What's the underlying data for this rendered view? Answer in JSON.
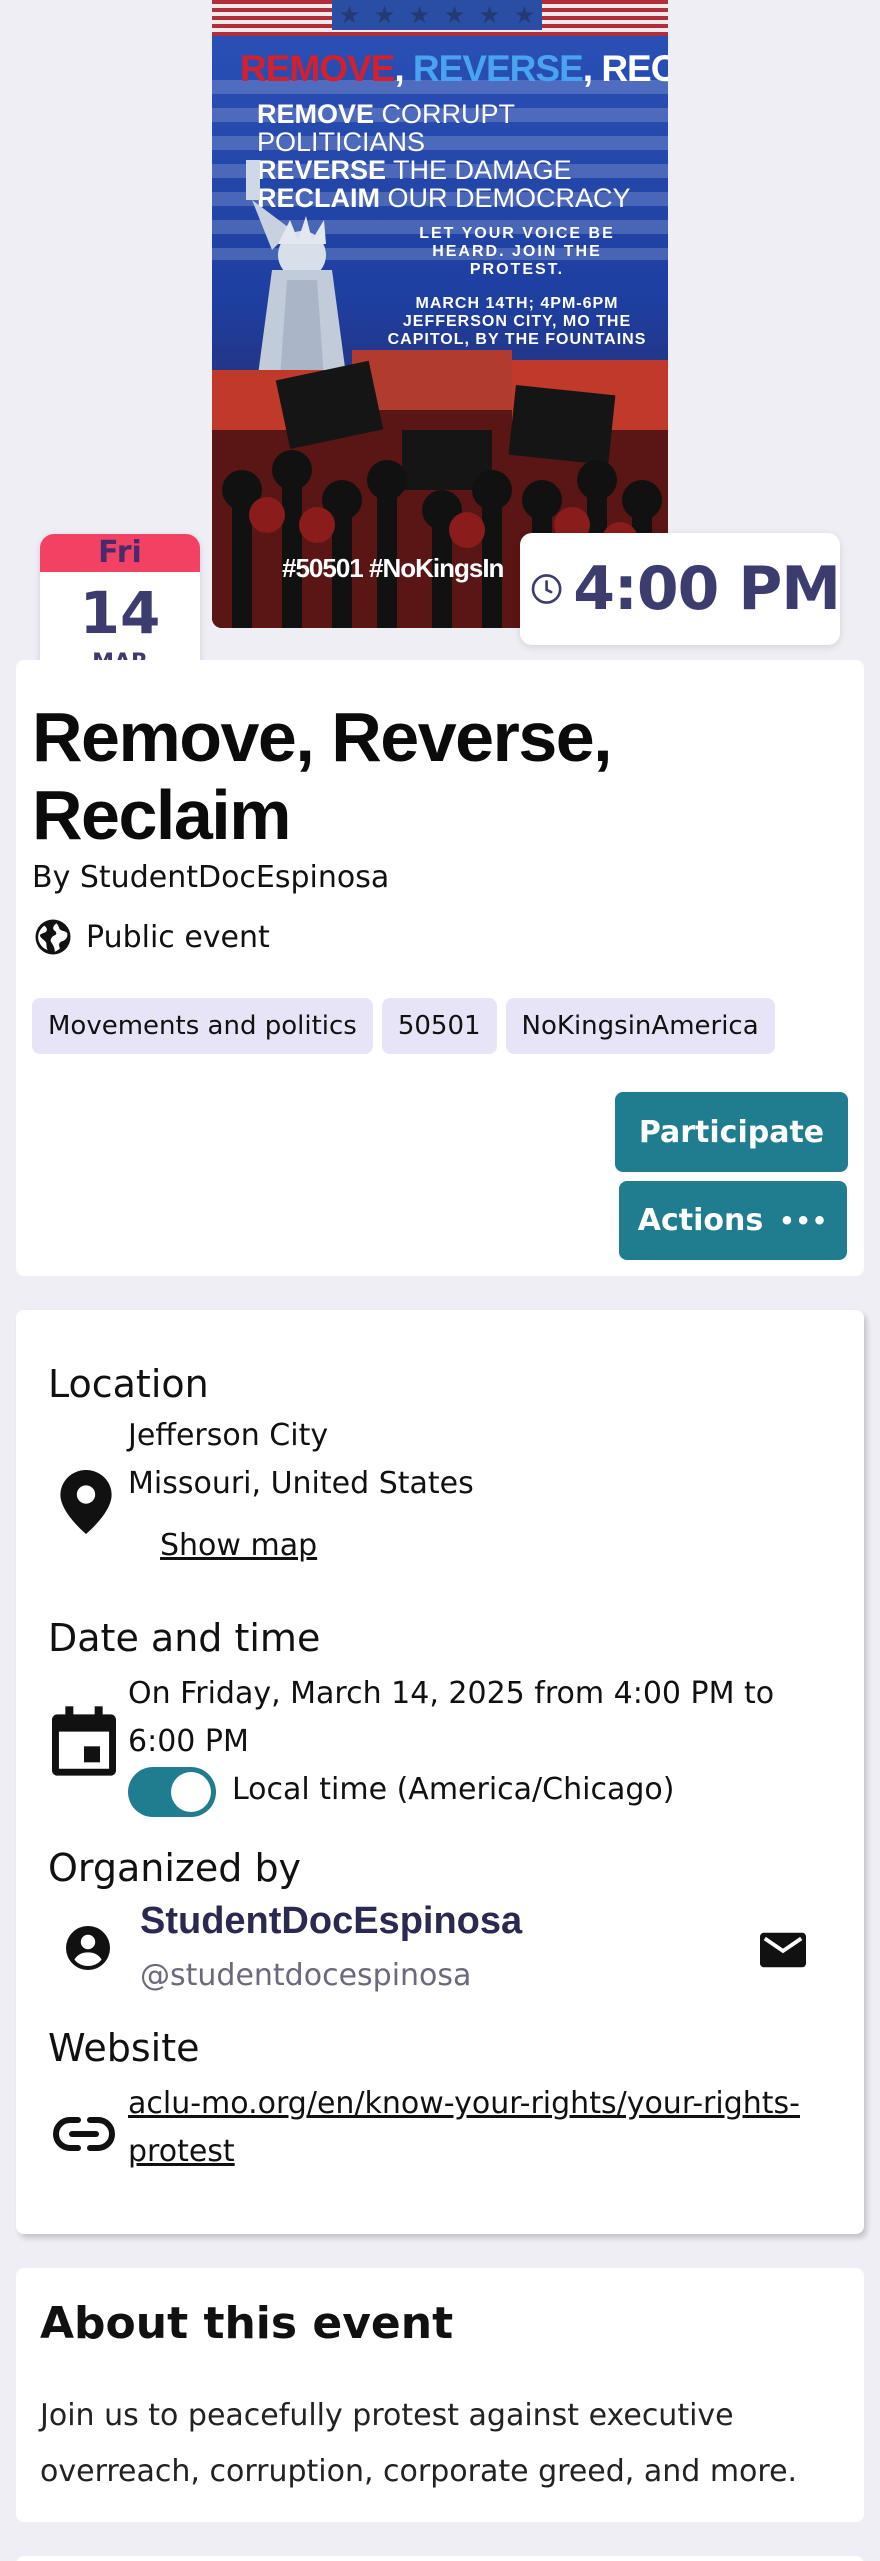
{
  "poster": {
    "headline_1": "REMOVE",
    "headline_sep_1": ", ",
    "headline_2": "REVERSE",
    "headline_sep_2": ", ",
    "headline_3": "RECLAIM",
    "line_1_bold": "REMOVE",
    "line_1_rest": " CORRUPT POLITICIANS",
    "line_2_bold": "REVERSE",
    "line_2_rest": " THE DAMAGE",
    "line_3_bold": "RECLAIM",
    "line_3_rest": " OUR DEMOCRACY",
    "message": "LET YOUR VOICE BE HEARD. JOIN THE PROTEST.",
    "details": "MARCH 14TH; 4PM-6PM JEFFERSON CITY, MO THE CAPITOL, BY THE FOUNTAINS",
    "hashtags": "#50501 #NoKingsIn"
  },
  "date_badge": {
    "weekday": "Fri",
    "day": "14",
    "month": "MAR"
  },
  "time_badge": {
    "time": "4:00 PM"
  },
  "event": {
    "title": "Remove, Reverse, Reclaim",
    "byline": "By StudentDocEspinosa",
    "visibility": "Public event",
    "tags": [
      "Movements and politics",
      "50501",
      "NoKingsinAmerica"
    ],
    "participate_label": "Participate",
    "actions_label": "Actions"
  },
  "details": {
    "location_heading": "Location",
    "location_line1": "Jefferson City",
    "location_line2": "Missouri, United States",
    "show_map_label": "Show map",
    "datetime_heading": "Date and time",
    "datetime_text": "On Friday, March 14, 2025 from 4:00 PM to 6:00 PM",
    "local_time_label": "Local time (America/Chicago)",
    "local_time_enabled": true,
    "organizer_heading": "Organized by",
    "organizer_name": "StudentDocEspinosa",
    "organizer_handle": "@studentdocespinosa",
    "website_heading": "Website",
    "website_url": "aclu-mo.org/en/know-your-rights/your-rights-protest"
  },
  "about": {
    "heading": "About this event",
    "body": "Join us to peacefully protest against executive overreach, corruption, corporate greed, and more."
  },
  "colors": {
    "accent": "#1f7d8f",
    "badge_red": "#f24162",
    "tag_bg": "#e6e4f6",
    "badge_text": "#3c3d6e"
  }
}
